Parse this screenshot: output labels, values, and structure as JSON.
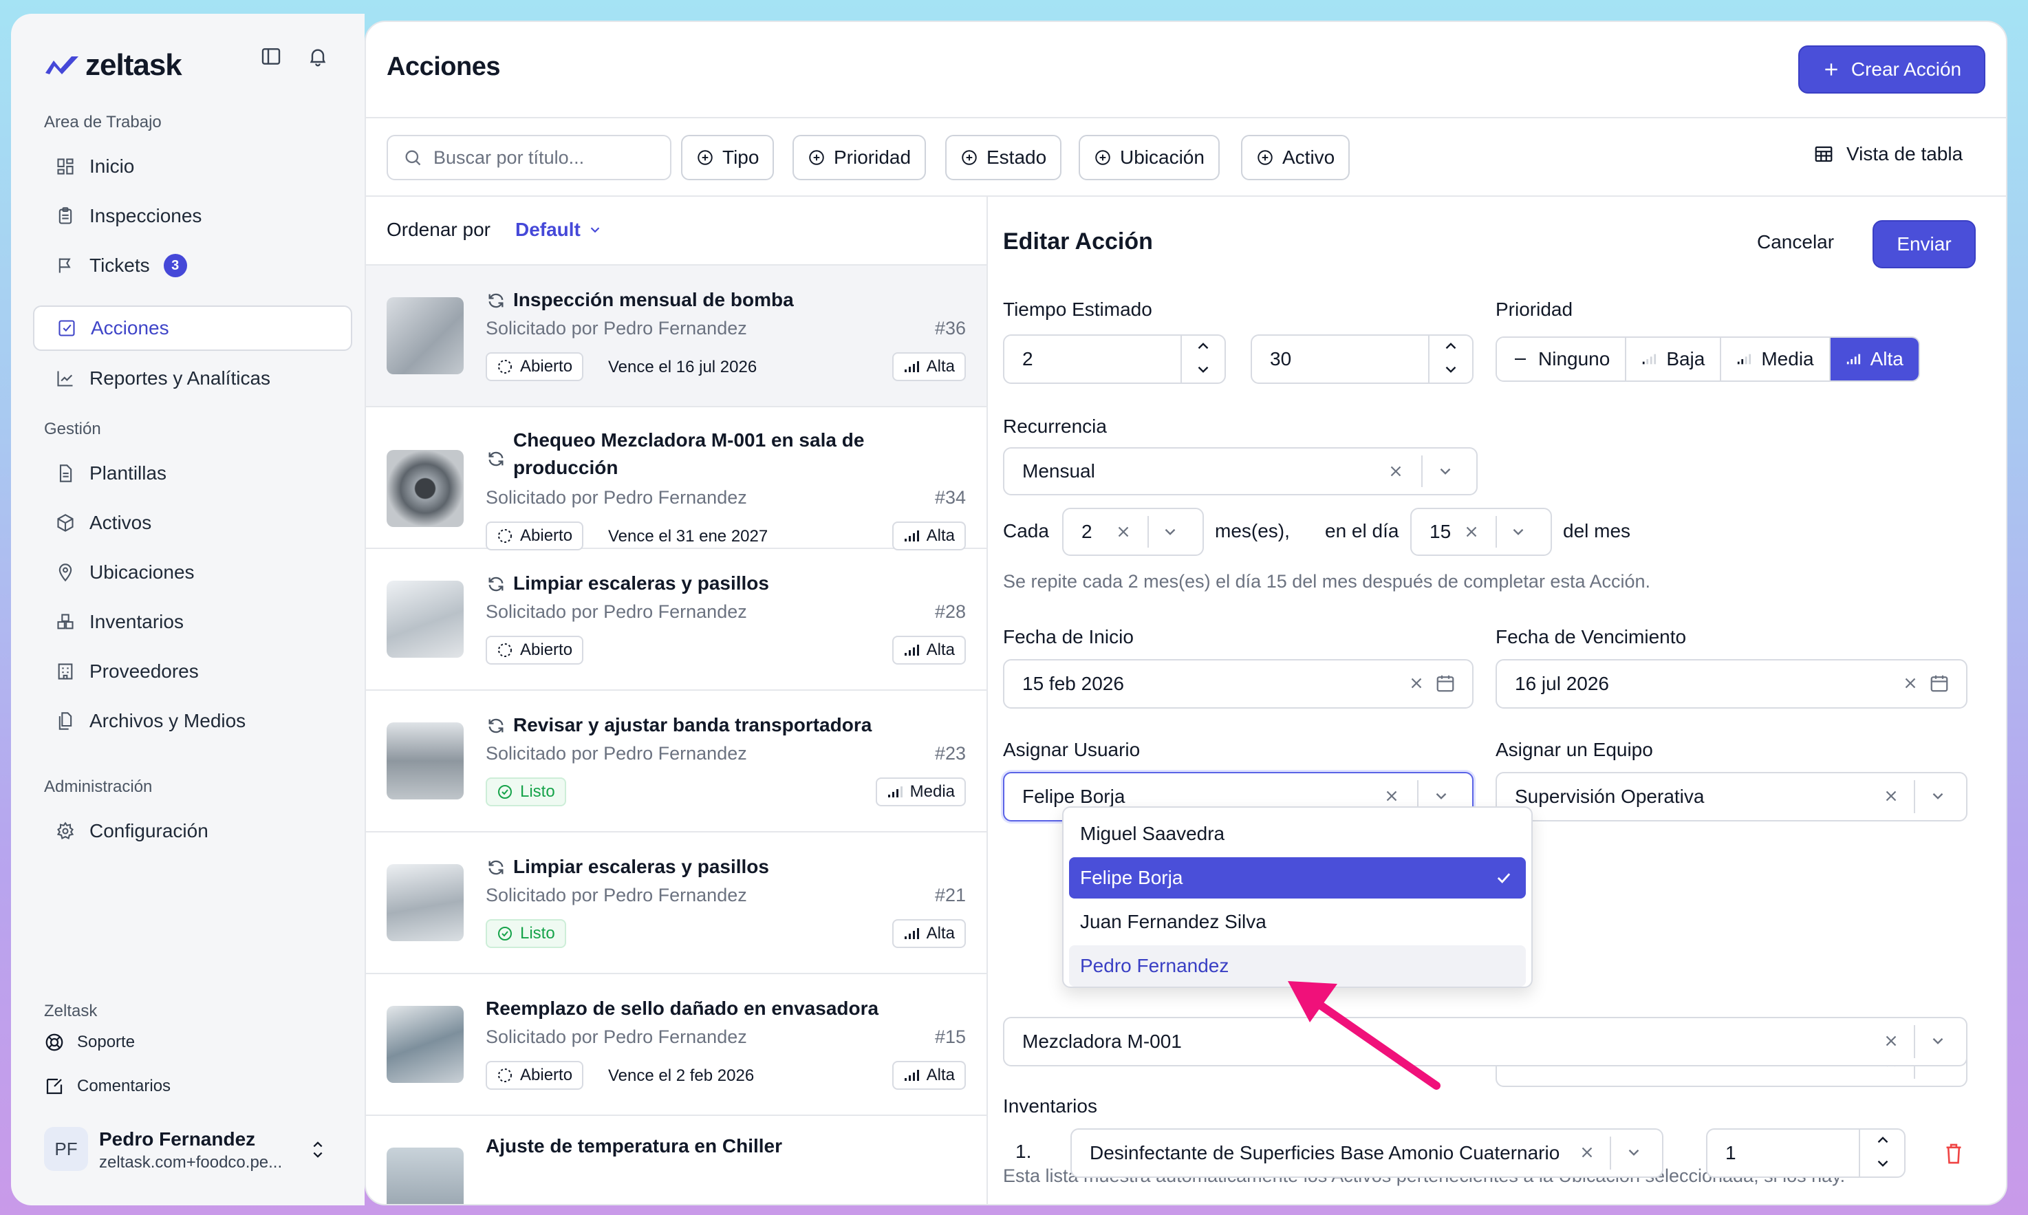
{
  "app": {
    "name": "zeltask"
  },
  "sidebar": {
    "workspace_label": "Area de Trabajo",
    "workspace_items": [
      {
        "label": "Inicio",
        "icon": "grid-icon"
      },
      {
        "label": "Inspecciones",
        "icon": "clipboard-icon"
      },
      {
        "label": "Tickets",
        "icon": "flag-icon",
        "badge": "3"
      },
      {
        "label": "Acciones",
        "icon": "check-square-icon",
        "active": true
      },
      {
        "label": "Reportes y Analíticas",
        "icon": "chart-icon"
      }
    ],
    "management_label": "Gestión",
    "management_items": [
      {
        "label": "Plantillas",
        "icon": "document-icon"
      },
      {
        "label": "Activos",
        "icon": "cube-icon"
      },
      {
        "label": "Ubicaciones",
        "icon": "pin-icon"
      },
      {
        "label": "Inventarios",
        "icon": "boxes-icon"
      },
      {
        "label": "Proveedores",
        "icon": "building-icon"
      },
      {
        "label": "Archivos y Medios",
        "icon": "files-icon"
      }
    ],
    "admin_label": "Administración",
    "admin_items": [
      {
        "label": "Configuración",
        "icon": "gear-icon"
      }
    ],
    "company_label": "Zeltask",
    "support_label": "Soporte",
    "feedback_label": "Comentarios",
    "user": {
      "initials": "PF",
      "name": "Pedro Fernandez",
      "email": "zeltask.com+foodco.pe..."
    }
  },
  "header": {
    "title": "Acciones",
    "create_label": "Crear Acción"
  },
  "toolbar": {
    "search_placeholder": "Buscar por título...",
    "filters": [
      "Tipo",
      "Prioridad",
      "Estado",
      "Ubicación",
      "Activo"
    ],
    "view_label": "Vista de tabla"
  },
  "list": {
    "sort_label": "Ordenar por",
    "sort_value": "Default",
    "items": [
      {
        "title": "Inspección mensual de bomba",
        "requested": "Solicitado por Pedro Fernandez",
        "num": "#36",
        "status": "Abierto",
        "due": "Vence el 16 jul 2026",
        "priority": "Alta",
        "recurring": true
      },
      {
        "title": "Chequeo Mezcladora M-001 en sala de producción",
        "requested": "Solicitado por Pedro Fernandez",
        "num": "#34",
        "status": "Abierto",
        "due": "Vence el 31 ene 2027",
        "priority": "Alta",
        "recurring": true
      },
      {
        "title": "Limpiar escaleras y pasillos",
        "requested": "Solicitado por Pedro Fernandez",
        "num": "#28",
        "status": "Abierto",
        "due": "",
        "priority": "Alta",
        "recurring": true
      },
      {
        "title": "Revisar y ajustar banda transportadora",
        "requested": "Solicitado por Pedro Fernandez",
        "num": "#23",
        "status": "Listo",
        "due": "",
        "priority": "Media",
        "recurring": true
      },
      {
        "title": "Limpiar escaleras y pasillos",
        "requested": "Solicitado por Pedro Fernandez",
        "num": "#21",
        "status": "Listo",
        "due": "",
        "priority": "Alta",
        "recurring": true
      },
      {
        "title": "Reemplazo de sello dañado en envasadora",
        "requested": "Solicitado por Pedro Fernandez",
        "num": "#15",
        "status": "Abierto",
        "due": "Vence el 2 feb 2026",
        "priority": "Alta",
        "recurring": false
      },
      {
        "title": "Ajuste de temperatura en Chiller",
        "requested": "",
        "num": "",
        "status": "",
        "due": "",
        "priority": "",
        "recurring": false
      }
    ]
  },
  "form": {
    "title": "Editar Acción",
    "cancel_label": "Cancelar",
    "submit_label": "Enviar",
    "time_label": "Tiempo Estimado",
    "hours": "2",
    "minutes": "30",
    "priority_label": "Prioridad",
    "priority_options": [
      "Ninguno",
      "Baja",
      "Media",
      "Alta"
    ],
    "priority_selected": "Alta",
    "recurrence_label": "Recurrencia",
    "recurrence_value": "Mensual",
    "every_label": "Cada",
    "every_value": "2",
    "months_label": "mes(es),",
    "day_label": "en el día",
    "day_value": "15",
    "of_month_label": "del mes",
    "recurrence_hint": "Se repite cada 2 mes(es) el día 15 del mes después de completar esta Acción.",
    "start_label": "Fecha de Inicio",
    "start_value": "15 feb 2026",
    "due_label": "Fecha de Vencimiento",
    "due_value": "16 jul 2026",
    "assign_user_label": "Asignar Usuario",
    "assign_user_value": "Felipe Borja",
    "assign_team_label": "Asignar un Equipo",
    "assign_team_value": "Supervisión Operativa",
    "user_options": [
      "Miguel Saavedra",
      "Felipe Borja",
      "Juan Fernandez Silva",
      "Pedro Fernandez"
    ],
    "asset_hint": "Esta lista muestra automáticamente los Activos pertenecientes a la Ubicación seleccionada, si los hay.",
    "asset_value": "Mezcladora M-001",
    "inventory_label": "Inventarios",
    "inventory_index": "1.",
    "inventory_item": "Desinfectante de Superficies Base Amonio Cuaternario",
    "inventory_qty": "1"
  },
  "colors": {
    "accent": "#4a4fd9",
    "arrow": "#f0117a",
    "success": "#16a34a"
  }
}
